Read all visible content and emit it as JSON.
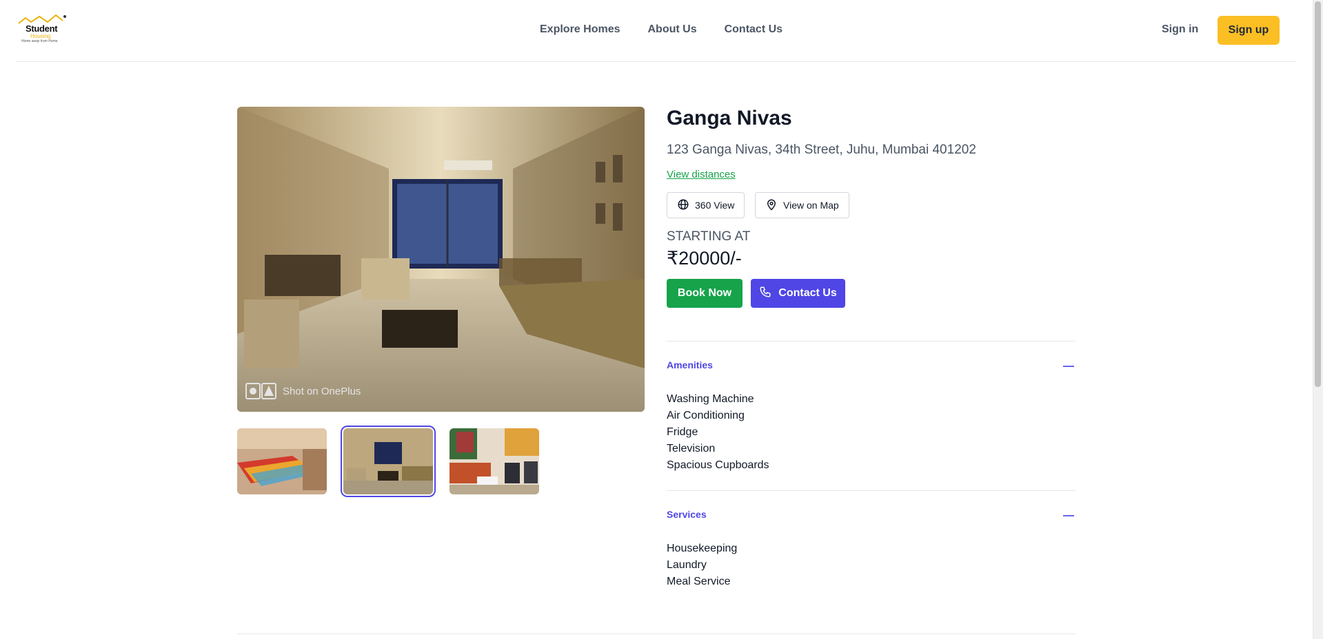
{
  "header": {
    "logo": {
      "line1": "Student",
      "line2": "Housing",
      "tagline": "Home away from Home"
    },
    "nav": [
      "Explore Homes",
      "About Us",
      "Contact Us"
    ],
    "sign_in": "Sign in",
    "sign_up": "Sign up"
  },
  "gallery": {
    "thumbnails": [
      "bedroom",
      "living-room",
      "lounge"
    ],
    "selected_index": 1
  },
  "property": {
    "name": "Ganga Nivas",
    "address": "123 Ganga Nivas, 34th Street, Juhu, Mumbai 401202",
    "view_distances": "View distances",
    "view_360": "360 View",
    "view_map": "View on Map",
    "starting_label": "STARTING AT",
    "price": "₹20000/-",
    "book_now": "Book Now",
    "contact_us": "Contact Us"
  },
  "amenities": {
    "title": "Amenities",
    "items": [
      "Washing Machine",
      "Air Conditioning",
      "Fridge",
      "Television",
      "Spacious Cupboards"
    ]
  },
  "services": {
    "title": "Services",
    "items": [
      "Housekeeping",
      "Laundry",
      "Meal Service"
    ]
  },
  "colors": {
    "accent": "#4f46e5",
    "green": "#16a34a",
    "yellow": "#fbbf24"
  }
}
